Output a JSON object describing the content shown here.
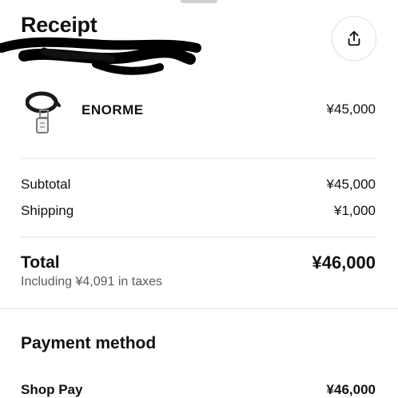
{
  "header": {
    "title": "Receipt",
    "share_icon": "share-icon"
  },
  "item": {
    "name": "ENORME",
    "price": "¥45,000",
    "thumbnail_icon": "product-thumbnail"
  },
  "summary": {
    "subtotal_label": "Subtotal",
    "subtotal_value": "¥45,000",
    "shipping_label": "Shipping",
    "shipping_value": "¥1,000",
    "total_label": "Total",
    "total_value": "¥46,000",
    "tax_note": "Including ¥4,091 in taxes"
  },
  "payment": {
    "section_title": "Payment method",
    "method_label": "Shop Pay",
    "method_amount": "¥46,000"
  }
}
